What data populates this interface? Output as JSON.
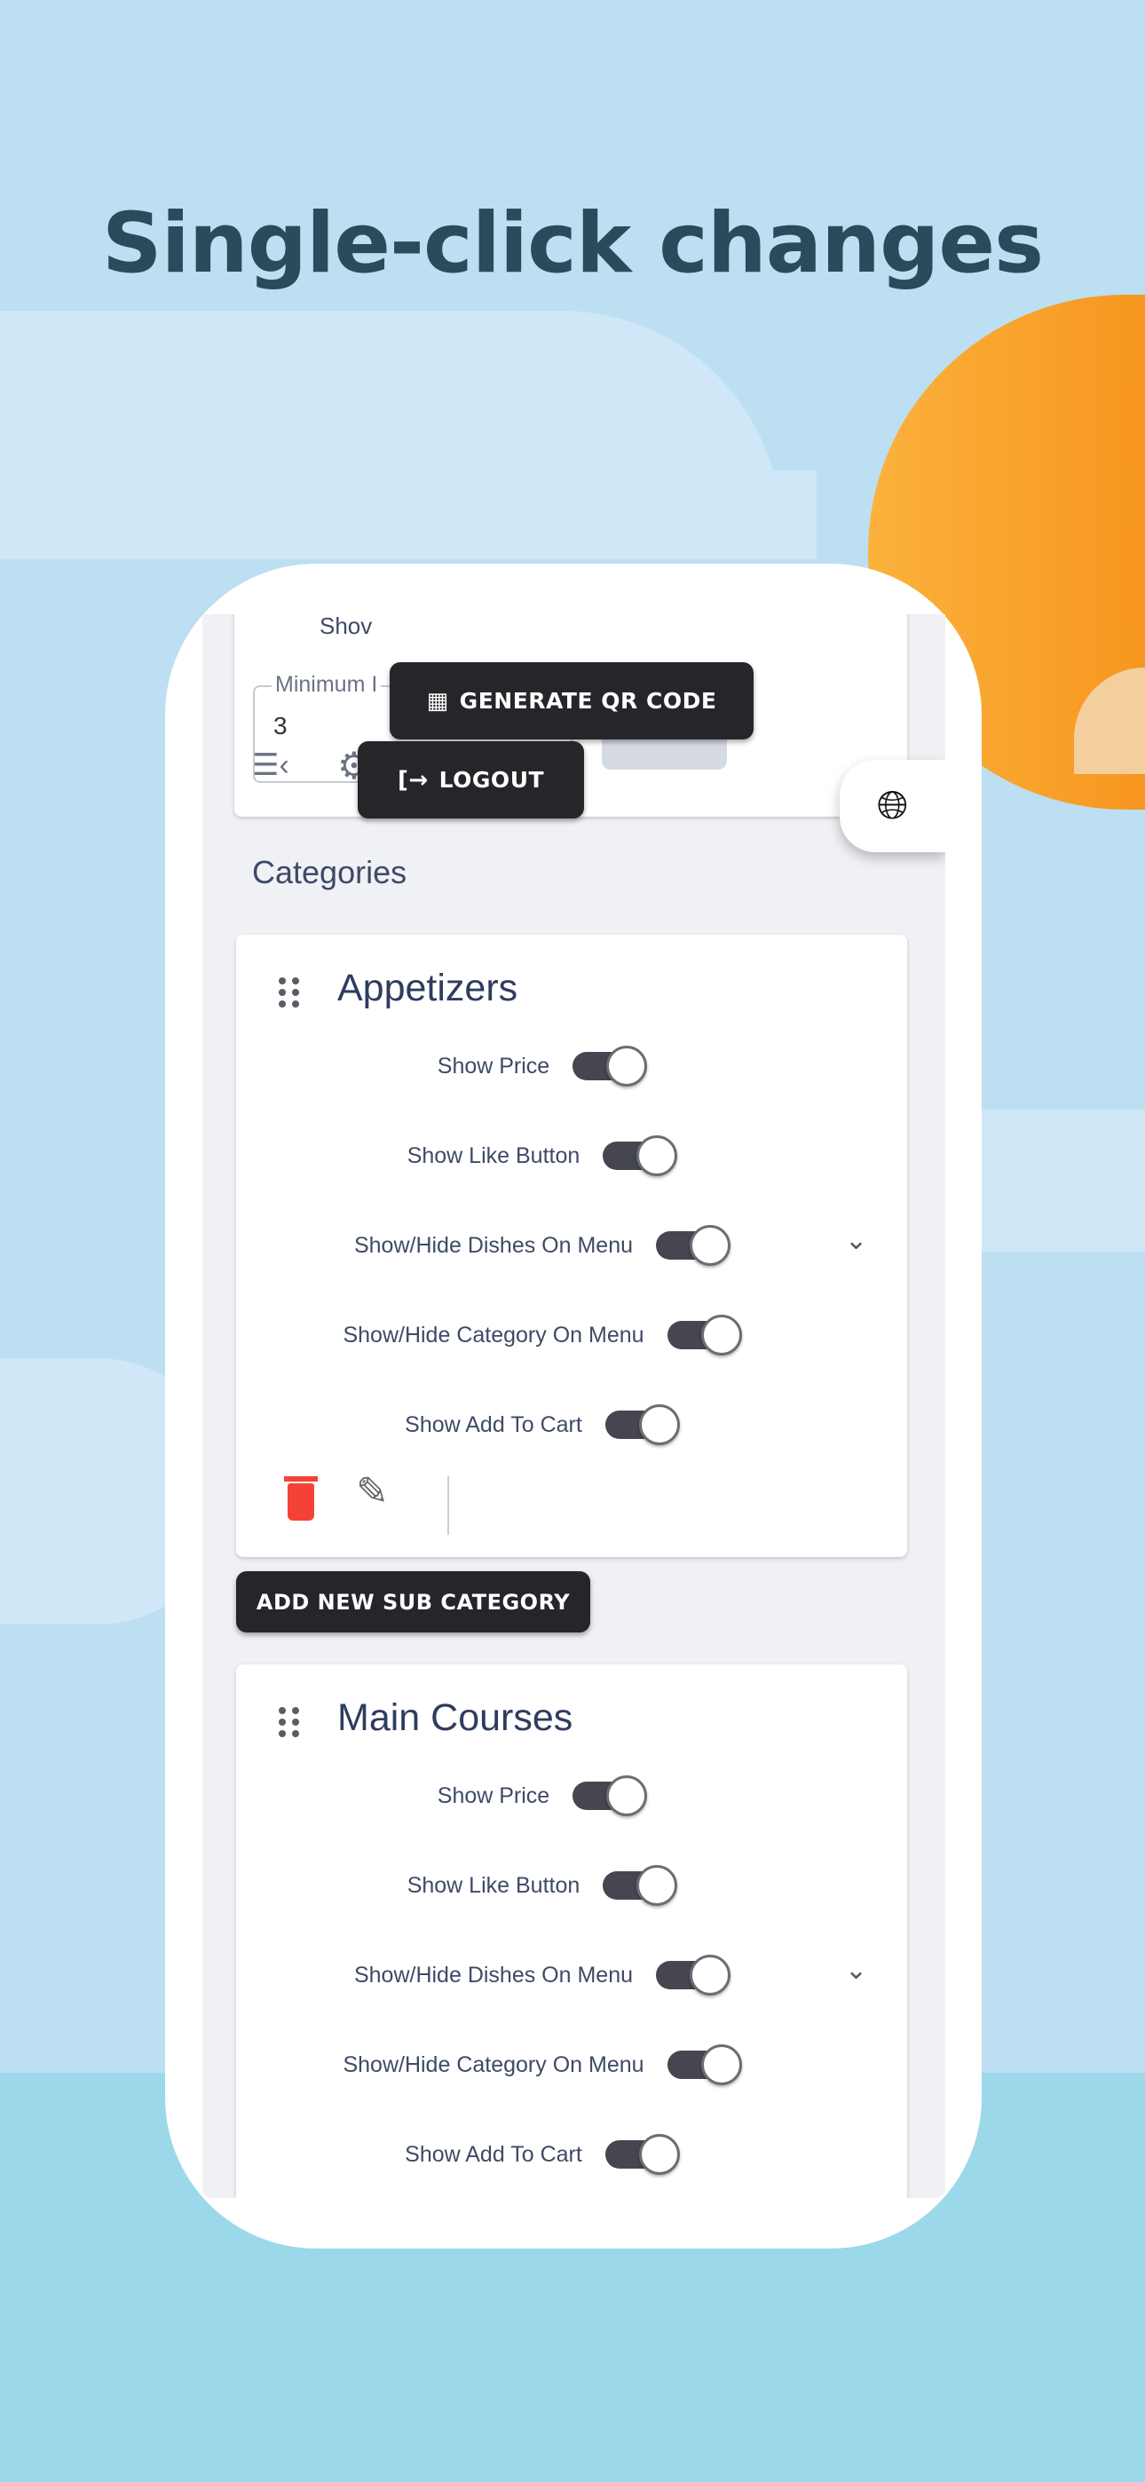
{
  "headline": "Single-click changes",
  "top_card": {
    "partial_label": "Shov",
    "field_label": "Minimum I",
    "field_value": "3"
  },
  "buttons": {
    "generate_qr": "GENERATE QR CODE",
    "logout": "LOGOUT",
    "add_sub_category": "ADD NEW SUB CATEGORY"
  },
  "section_title": "Categories",
  "colors": {
    "toggle_track": "#45464f",
    "button_dark": "#26262a",
    "delete_red": "#f44336",
    "sun": "#f7961f"
  },
  "categories": [
    {
      "name": "Appetizers",
      "toggles": [
        {
          "label": "Show Price",
          "on": true
        },
        {
          "label": "Show Like Button",
          "on": true
        },
        {
          "label": "Show/Hide Dishes On Menu",
          "on": true
        },
        {
          "label": "Show/Hide Category On Menu",
          "on": true
        },
        {
          "label": "Show Add To Cart",
          "on": true
        }
      ]
    },
    {
      "name": "Main Courses",
      "toggles": [
        {
          "label": "Show Price",
          "on": true
        },
        {
          "label": "Show Like Button",
          "on": true
        },
        {
          "label": "Show/Hide Dishes On Menu",
          "on": true
        },
        {
          "label": "Show/Hide Category On Menu",
          "on": true
        },
        {
          "label": "Show Add To Cart",
          "on": true
        }
      ]
    }
  ]
}
